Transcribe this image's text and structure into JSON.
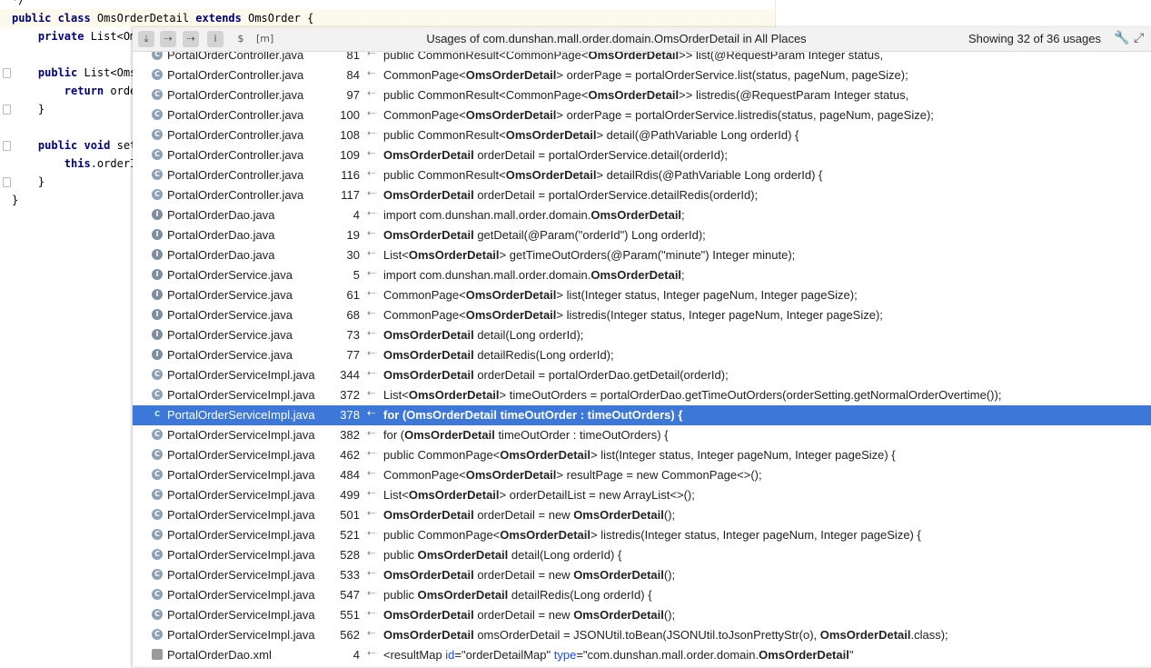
{
  "editor": {
    "lines": [
      {
        "pre": "*/",
        "kw": "",
        "post": ""
      },
      {
        "pre": "",
        "kw": "public class ",
        "post": "OmsOrderDetail ",
        "kw2": "extends",
        "post2": " OmsOrder {"
      },
      {
        "pre": "    ",
        "kw": "private ",
        "post": "List<Om"
      },
      {
        "pre": "",
        "kw": "",
        "post": ""
      },
      {
        "pre": "    ",
        "kw": "public ",
        "post": "List<Oms"
      },
      {
        "pre": "        ",
        "kw": "return ",
        "post": "orde"
      },
      {
        "pre": "    ",
        "kw": "",
        "post": "}"
      },
      {
        "pre": "",
        "kw": "",
        "post": ""
      },
      {
        "pre": "    ",
        "kw": "public void ",
        "post": "set"
      },
      {
        "pre": "        ",
        "kw": "this",
        "post": ".orderI"
      },
      {
        "pre": "    ",
        "kw": "",
        "post": "}"
      },
      {
        "pre": "",
        "kw": "",
        "post": "}"
      }
    ]
  },
  "popup": {
    "title": "Usages of com.dunshan.mall.order.domain.OmsOrderDetail in All Places",
    "showing": "Showing 32 of 36 usages",
    "toolbar": [
      "⤓",
      "⇢",
      "⇢",
      "i",
      "$",
      "[m]"
    ],
    "rows": [
      {
        "icon": "C",
        "file": "PortalOrderController.java",
        "line": "81",
        "code": [
          [
            "t",
            "public CommonResult<CommonPage<"
          ],
          [
            "b",
            "OmsOrderDetail"
          ],
          [
            "t",
            ">> list(@RequestParam Integer status,"
          ]
        ]
      },
      {
        "icon": "C",
        "file": "PortalOrderController.java",
        "line": "84",
        "code": [
          [
            "t",
            "CommonPage<"
          ],
          [
            "b",
            "OmsOrderDetail"
          ],
          [
            "t",
            "> orderPage = portalOrderService.list(status, pageNum, pageSize);"
          ]
        ]
      },
      {
        "icon": "C",
        "file": "PortalOrderController.java",
        "line": "97",
        "code": [
          [
            "t",
            "public CommonResult<CommonPage<"
          ],
          [
            "b",
            "OmsOrderDetail"
          ],
          [
            "t",
            ">> listredis(@RequestParam Integer status,"
          ]
        ]
      },
      {
        "icon": "C",
        "file": "PortalOrderController.java",
        "line": "100",
        "code": [
          [
            "t",
            "CommonPage<"
          ],
          [
            "b",
            "OmsOrderDetail"
          ],
          [
            "t",
            "> orderPage = portalOrderService.listredis(status, pageNum, pageSize);"
          ]
        ]
      },
      {
        "icon": "C",
        "file": "PortalOrderController.java",
        "line": "108",
        "code": [
          [
            "t",
            "public CommonResult<"
          ],
          [
            "b",
            "OmsOrderDetail"
          ],
          [
            "t",
            "> detail(@PathVariable Long orderId) {"
          ]
        ]
      },
      {
        "icon": "C",
        "file": "PortalOrderController.java",
        "line": "109",
        "code": [
          [
            "b",
            "OmsOrderDetail"
          ],
          [
            "t",
            " orderDetail = portalOrderService.detail(orderId);"
          ]
        ]
      },
      {
        "icon": "C",
        "file": "PortalOrderController.java",
        "line": "116",
        "code": [
          [
            "t",
            "public CommonResult<"
          ],
          [
            "b",
            "OmsOrderDetail"
          ],
          [
            "t",
            "> detailRdis(@PathVariable Long orderId) {"
          ]
        ]
      },
      {
        "icon": "C",
        "file": "PortalOrderController.java",
        "line": "117",
        "code": [
          [
            "b",
            "OmsOrderDetail"
          ],
          [
            "t",
            " orderDetail = portalOrderService.detailRedis(orderId);"
          ]
        ]
      },
      {
        "icon": "I",
        "file": "PortalOrderDao.java",
        "line": "4",
        "code": [
          [
            "t",
            "import com.dunshan.mall.order.domain."
          ],
          [
            "b",
            "OmsOrderDetail"
          ],
          [
            "t",
            ";"
          ]
        ]
      },
      {
        "icon": "I",
        "file": "PortalOrderDao.java",
        "line": "19",
        "code": [
          [
            "b",
            "OmsOrderDetail"
          ],
          [
            "t",
            " getDetail(@Param(\"orderId\") Long orderId);"
          ]
        ]
      },
      {
        "icon": "I",
        "file": "PortalOrderDao.java",
        "line": "30",
        "code": [
          [
            "t",
            "List<"
          ],
          [
            "b",
            "OmsOrderDetail"
          ],
          [
            "t",
            "> getTimeOutOrders(@Param(\"minute\") Integer minute);"
          ]
        ]
      },
      {
        "icon": "I",
        "file": "PortalOrderService.java",
        "line": "5",
        "code": [
          [
            "t",
            "import com.dunshan.mall.order.domain."
          ],
          [
            "b",
            "OmsOrderDetail"
          ],
          [
            "t",
            ";"
          ]
        ]
      },
      {
        "icon": "I",
        "file": "PortalOrderService.java",
        "line": "61",
        "code": [
          [
            "t",
            "CommonPage<"
          ],
          [
            "b",
            "OmsOrderDetail"
          ],
          [
            "t",
            "> list(Integer status, Integer pageNum, Integer pageSize);"
          ]
        ]
      },
      {
        "icon": "I",
        "file": "PortalOrderService.java",
        "line": "68",
        "code": [
          [
            "t",
            "CommonPage<"
          ],
          [
            "b",
            "OmsOrderDetail"
          ],
          [
            "t",
            "> listredis(Integer status, Integer pageNum, Integer pageSize);"
          ]
        ]
      },
      {
        "icon": "I",
        "file": "PortalOrderService.java",
        "line": "73",
        "code": [
          [
            "b",
            "OmsOrderDetail"
          ],
          [
            "t",
            " detail(Long orderId);"
          ]
        ]
      },
      {
        "icon": "I",
        "file": "PortalOrderService.java",
        "line": "77",
        "code": [
          [
            "b",
            "OmsOrderDetail"
          ],
          [
            "t",
            " detailRedis(Long orderId);"
          ]
        ]
      },
      {
        "icon": "C",
        "file": "PortalOrderServiceImpl.java",
        "line": "344",
        "code": [
          [
            "b",
            "OmsOrderDetail"
          ],
          [
            "t",
            " orderDetail = portalOrderDao.getDetail(orderId);"
          ]
        ]
      },
      {
        "icon": "C",
        "file": "PortalOrderServiceImpl.java",
        "line": "372",
        "code": [
          [
            "t",
            "List<"
          ],
          [
            "b",
            "OmsOrderDetail"
          ],
          [
            "t",
            "> timeOutOrders = portalOrderDao.getTimeOutOrders(orderSetting.getNormalOrderOvertime());"
          ]
        ]
      },
      {
        "icon": "C",
        "file": "PortalOrderServiceImpl.java",
        "line": "378",
        "selected": true,
        "code": [
          [
            "t",
            "for ("
          ],
          [
            "b",
            "OmsOrderDetail"
          ],
          [
            "t",
            " timeOutOrder : timeOutOrders) {"
          ]
        ]
      },
      {
        "icon": "C",
        "file": "PortalOrderServiceImpl.java",
        "line": "382",
        "code": [
          [
            "t",
            "for ("
          ],
          [
            "b",
            "OmsOrderDetail"
          ],
          [
            "t",
            " timeOutOrder : timeOutOrders) {"
          ]
        ]
      },
      {
        "icon": "C",
        "file": "PortalOrderServiceImpl.java",
        "line": "462",
        "code": [
          [
            "t",
            "public CommonPage<"
          ],
          [
            "b",
            "OmsOrderDetail"
          ],
          [
            "t",
            "> list(Integer status, Integer pageNum, Integer pageSize) {"
          ]
        ]
      },
      {
        "icon": "C",
        "file": "PortalOrderServiceImpl.java",
        "line": "484",
        "code": [
          [
            "t",
            "CommonPage<"
          ],
          [
            "b",
            "OmsOrderDetail"
          ],
          [
            "t",
            "> resultPage = new CommonPage<>();"
          ]
        ]
      },
      {
        "icon": "C",
        "file": "PortalOrderServiceImpl.java",
        "line": "499",
        "code": [
          [
            "t",
            "List<"
          ],
          [
            "b",
            "OmsOrderDetail"
          ],
          [
            "t",
            "> orderDetailList = new ArrayList<>();"
          ]
        ]
      },
      {
        "icon": "C",
        "file": "PortalOrderServiceImpl.java",
        "line": "501",
        "code": [
          [
            "b",
            "OmsOrderDetail"
          ],
          [
            "t",
            " orderDetail = new "
          ],
          [
            "b",
            "OmsOrderDetail"
          ],
          [
            "t",
            "();"
          ]
        ]
      },
      {
        "icon": "C",
        "file": "PortalOrderServiceImpl.java",
        "line": "521",
        "code": [
          [
            "t",
            "public CommonPage<"
          ],
          [
            "b",
            "OmsOrderDetail"
          ],
          [
            "t",
            "> listredis(Integer status, Integer pageNum, Integer pageSize) {"
          ]
        ]
      },
      {
        "icon": "C",
        "file": "PortalOrderServiceImpl.java",
        "line": "528",
        "code": [
          [
            "t",
            "public "
          ],
          [
            "b",
            "OmsOrderDetail"
          ],
          [
            "t",
            " detail(Long orderId) {"
          ]
        ]
      },
      {
        "icon": "C",
        "file": "PortalOrderServiceImpl.java",
        "line": "533",
        "code": [
          [
            "b",
            "OmsOrderDetail"
          ],
          [
            "t",
            " orderDetail = new "
          ],
          [
            "b",
            "OmsOrderDetail"
          ],
          [
            "t",
            "();"
          ]
        ]
      },
      {
        "icon": "C",
        "file": "PortalOrderServiceImpl.java",
        "line": "547",
        "code": [
          [
            "t",
            "public "
          ],
          [
            "b",
            "OmsOrderDetail"
          ],
          [
            "t",
            " detailRedis(Long orderId) {"
          ]
        ]
      },
      {
        "icon": "C",
        "file": "PortalOrderServiceImpl.java",
        "line": "551",
        "code": [
          [
            "b",
            "OmsOrderDetail"
          ],
          [
            "t",
            " orderDetail = new "
          ],
          [
            "b",
            "OmsOrderDetail"
          ],
          [
            "t",
            "();"
          ]
        ]
      },
      {
        "icon": "C",
        "file": "PortalOrderServiceImpl.java",
        "line": "562",
        "code": [
          [
            "b",
            "OmsOrderDetail"
          ],
          [
            "t",
            " omsOrderDetail = JSONUtil.toBean(JSONUtil.toJsonPrettyStr(o), "
          ],
          [
            "b",
            "OmsOrderDetail"
          ],
          [
            "t",
            ".class);"
          ]
        ]
      },
      {
        "icon": "X",
        "file": "PortalOrderDao.xml",
        "line": "4",
        "code": [
          [
            "t",
            "<resultMap "
          ],
          [
            "a",
            "id"
          ],
          [
            "t",
            "=\"orderDetailMap\" "
          ],
          [
            "a",
            "type"
          ],
          [
            "t",
            "=\"com.dunshan.mall.order.domain."
          ],
          [
            "b",
            "OmsOrderDetail"
          ],
          [
            "t",
            "\""
          ]
        ]
      }
    ]
  },
  "colors": {
    "selection": "#3d78d8",
    "header": "#f2f2f2"
  }
}
